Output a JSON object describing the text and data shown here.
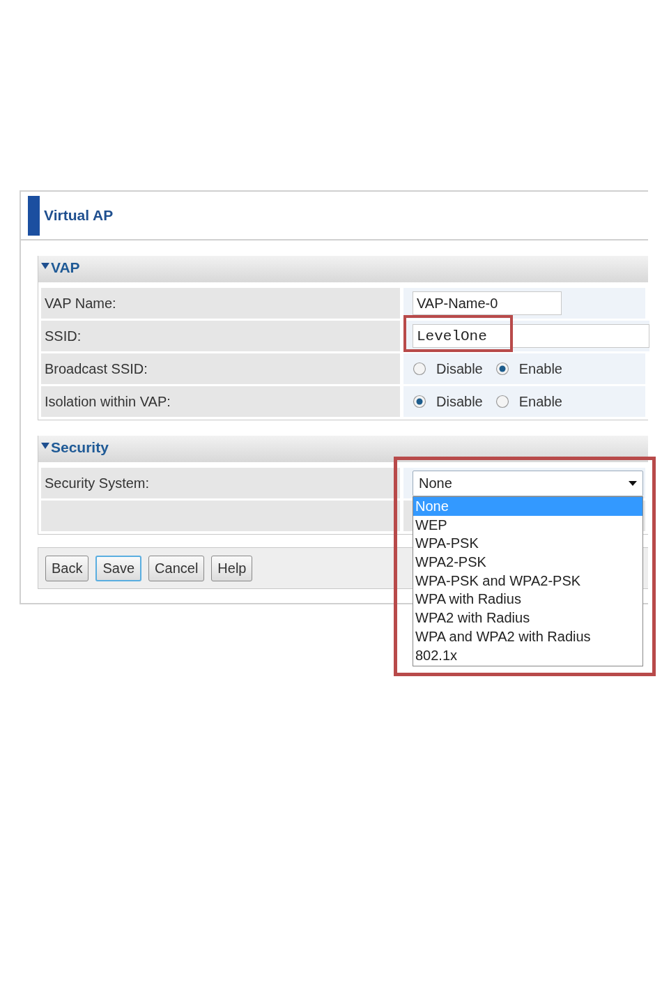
{
  "window": {
    "title": "Virtual AP"
  },
  "sections": [
    {
      "title": "VAP",
      "expanded": true,
      "rows": [
        {
          "kind": "text",
          "label": "VAP Name:",
          "value": "VAP-Name-0",
          "highlighted": false
        },
        {
          "kind": "text",
          "label": "SSID:",
          "value": "LevelOne",
          "highlighted": true
        },
        {
          "kind": "radio",
          "label": "Broadcast SSID:",
          "options": [
            {
              "label": "Disable",
              "selected": false
            },
            {
              "label": "Enable",
              "selected": true
            }
          ]
        },
        {
          "kind": "radio",
          "label": "Isolation within VAP:",
          "options": [
            {
              "label": "Disable",
              "selected": true
            },
            {
              "label": "Enable",
              "selected": false
            }
          ]
        }
      ]
    },
    {
      "title": "Security",
      "expanded": true,
      "rows": [
        {
          "kind": "select",
          "label": "Security System:",
          "value": "None",
          "highlighted": true,
          "open": true,
          "options": [
            {
              "label": "None",
              "selected": true
            },
            {
              "label": "WEP",
              "selected": false
            },
            {
              "label": "WPA-PSK",
              "selected": false
            },
            {
              "label": "WPA2-PSK",
              "selected": false
            },
            {
              "label": "WPA-PSK and WPA2-PSK",
              "selected": false
            },
            {
              "label": "WPA with Radius",
              "selected": false
            },
            {
              "label": "WPA2 with Radius",
              "selected": false
            },
            {
              "label": "WPA and WPA2 with Radius",
              "selected": false
            },
            {
              "label": "802.1x",
              "selected": false
            }
          ]
        },
        {
          "kind": "empty"
        }
      ]
    }
  ],
  "buttons": [
    {
      "label": "Back",
      "focused": false
    },
    {
      "label": "Save",
      "focused": true
    },
    {
      "label": "Cancel",
      "focused": false
    },
    {
      "label": "Help",
      "focused": false
    }
  ]
}
